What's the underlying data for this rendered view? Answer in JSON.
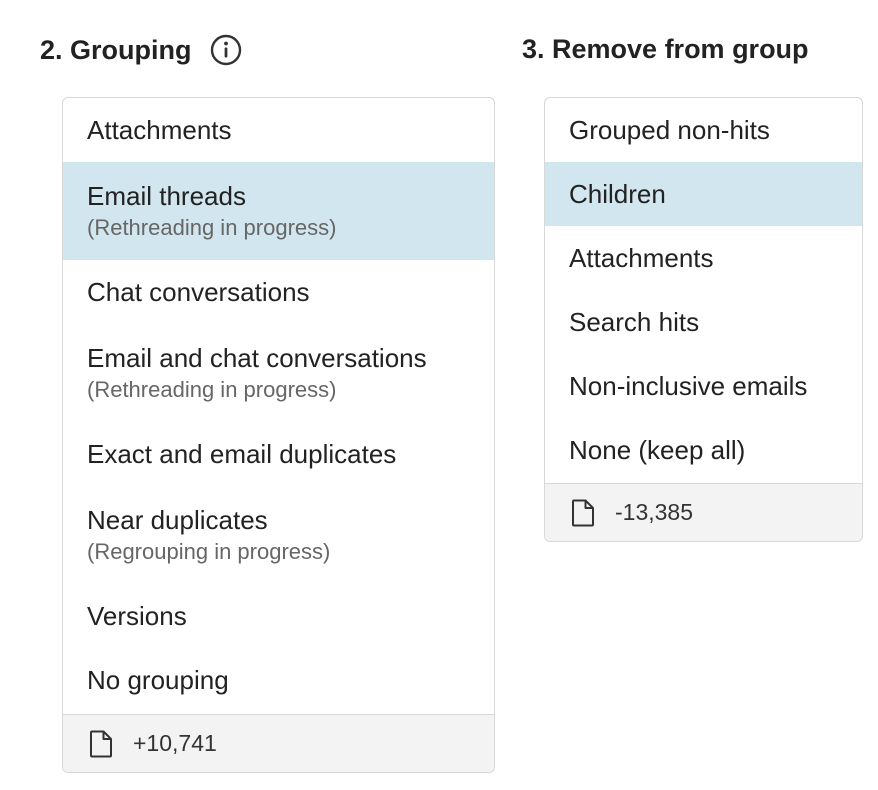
{
  "grouping": {
    "title": "2. Grouping",
    "info_icon": "info-circle-icon",
    "options": [
      {
        "label": "Attachments",
        "sub": ""
      },
      {
        "label": "Email threads",
        "sub": "(Rethreading in progress)"
      },
      {
        "label": "Chat conversations",
        "sub": ""
      },
      {
        "label": "Email and chat conversations",
        "sub": "(Rethreading in progress)"
      },
      {
        "label": "Exact and email duplicates",
        "sub": ""
      },
      {
        "label": "Near duplicates",
        "sub": "(Regrouping in progress)"
      },
      {
        "label": "Versions",
        "sub": ""
      },
      {
        "label": "No grouping",
        "sub": ""
      }
    ],
    "selected": "Email threads",
    "footer": {
      "icon": "document-icon",
      "count": "+10,741"
    }
  },
  "remove": {
    "title": "3. Remove from group",
    "options": [
      {
        "label": "Grouped non-hits"
      },
      {
        "label": "Children"
      },
      {
        "label": "Attachments"
      },
      {
        "label": "Search hits"
      },
      {
        "label": "Non-inclusive emails"
      },
      {
        "label": "None (keep all)"
      }
    ],
    "selected": "Children",
    "footer": {
      "icon": "document-icon",
      "count": "-13,385"
    }
  },
  "colors": {
    "selected_bg": "#d2e6ef",
    "panel_border": "#d8d8d8",
    "footer_bg": "#f3f3f3"
  }
}
